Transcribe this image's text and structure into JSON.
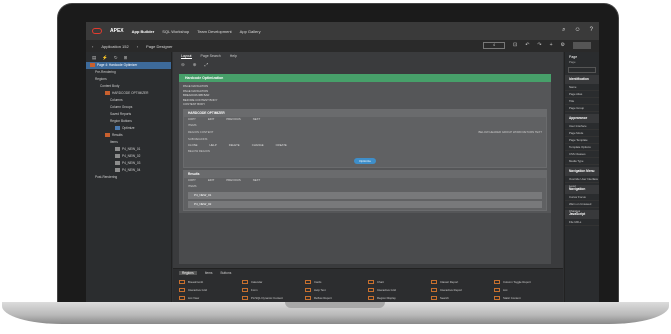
{
  "topbar": {
    "brand": "APEX",
    "menus": [
      "App Builder",
      "SQL Workshop",
      "Team Development",
      "App Gallery"
    ],
    "active_menu": "App Builder"
  },
  "breadcrumb": [
    "Application 152",
    "Page Designer"
  ],
  "tree": [
    {
      "label": "Page 4: Hardcode Optimizer",
      "level": 0,
      "icon": "page",
      "selected": true
    },
    {
      "label": "Pre-Rendering",
      "level": 1,
      "icon": "none"
    },
    {
      "label": "Regions",
      "level": 1,
      "icon": "none"
    },
    {
      "label": "Content Body",
      "level": 2,
      "icon": "none"
    },
    {
      "label": "HARDCODE OPTIMIZER",
      "level": 3,
      "icon": "region"
    },
    {
      "label": "Columns",
      "level": 4,
      "icon": "none"
    },
    {
      "label": "Column Groups",
      "level": 4,
      "icon": "none"
    },
    {
      "label": "Saved Reports",
      "level": 4,
      "icon": "none"
    },
    {
      "label": "Region Buttons",
      "level": 4,
      "icon": "none"
    },
    {
      "label": "Optimize",
      "level": 5,
      "icon": "button"
    },
    {
      "label": "Results",
      "level": 3,
      "icon": "region"
    },
    {
      "label": "Items",
      "level": 4,
      "icon": "none"
    },
    {
      "label": "P4_NEW_01",
      "level": 5,
      "icon": "item"
    },
    {
      "label": "P4_NEW_02",
      "level": 5,
      "icon": "item"
    },
    {
      "label": "P4_NEW_03",
      "level": 5,
      "icon": "item"
    },
    {
      "label": "P4_NEW_04",
      "level": 5,
      "icon": "item"
    },
    {
      "label": "Post-Rendering",
      "level": 1,
      "icon": "none"
    }
  ],
  "center_tabs": [
    "Layout",
    "Page Search",
    "Help"
  ],
  "canvas": {
    "region_title": "Hardcode Optimization",
    "slots": [
      "PAGE NAVIGATION",
      "PAGE NAVIGATION",
      "BREADCRUMB BAR",
      "BEFORE CONTENT BODY",
      "CONTENT BODY"
    ],
    "sub_title": "HARDCODE OPTIMIZER",
    "button_slots": [
      "COPY",
      "EDIT",
      "PREVIOUS",
      "NEXT"
    ],
    "item_slots": [
      "ITEMS",
      "REGION CONTENT"
    ],
    "right_note": "BELOW HEADER GROUP WORD RETURN TEXT",
    "sub_slots": [
      "SUB REGIONS"
    ],
    "button_slots2": [
      "CLOSE",
      "HELP",
      "DELETE",
      "CHANGE",
      "CREATE"
    ],
    "below_items": "BELOW REGION",
    "optimize_label": "Optimize",
    "results_title": "Results",
    "results_buttons": [
      "COPY",
      "EDIT",
      "PREVIOUS",
      "NEXT"
    ],
    "results_items_label": "ITEMS",
    "items": [
      "P4_NEW_01",
      "P4_NEW_02"
    ]
  },
  "gallery": {
    "tabs": [
      "Regions",
      "Items",
      "Buttons"
    ],
    "active_tab": "Regions",
    "cells": [
      "Breadcrumb",
      "Calendar",
      "Cards",
      "Chart",
      "Classic Report",
      "Column Toggle Report",
      "Interactive Grid",
      "Form",
      "Help Text",
      "Interactive Grid",
      "Interactive Report",
      "List",
      "List View",
      "PL/SQL Dynamic Content",
      "Reflow Report",
      "Region Display",
      "Search",
      "Static Content"
    ]
  },
  "right": {
    "title": "Page",
    "sub": "Page",
    "sections": [
      {
        "title": "Identification",
        "fields": [
          "Name",
          "Page Alias",
          "Title",
          "Page Group"
        ]
      },
      {
        "title": "Appearance",
        "fields": [
          "User Interface",
          "Page Mode",
          "Page Template",
          "Template Options",
          "CSS Classes",
          "Media Type"
        ]
      },
      {
        "title": "Navigation Menu",
        "fields": [
          "Override User Interface Level"
        ]
      },
      {
        "title": "Navigation",
        "fields": [
          "Cursor Focus",
          "Warn on Unsaved Changes"
        ]
      },
      {
        "title": "JavaScript",
        "fields": [
          "File URLs"
        ]
      }
    ]
  }
}
